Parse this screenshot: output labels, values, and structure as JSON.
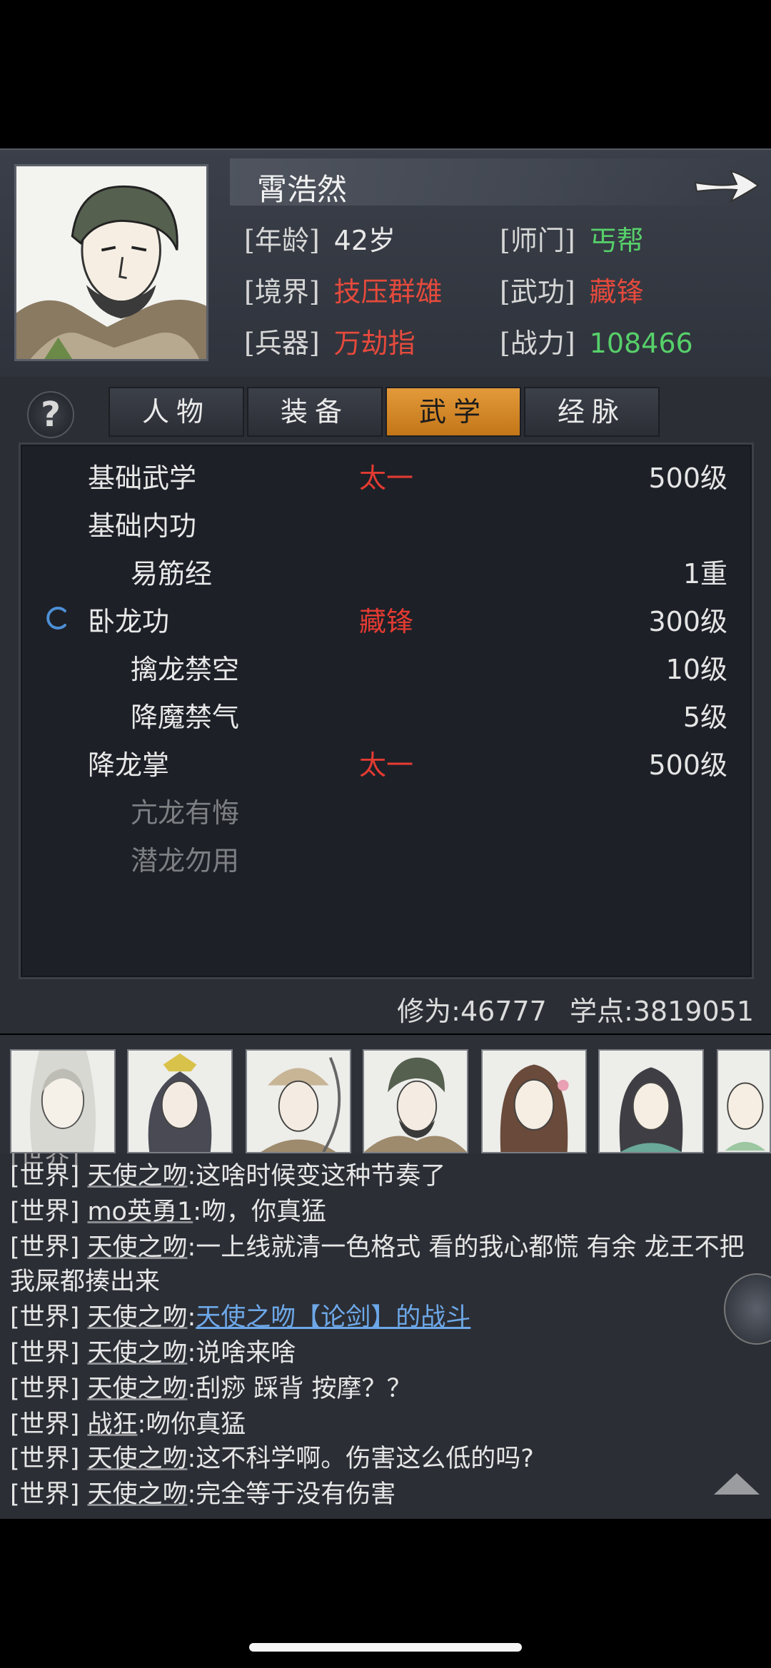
{
  "character": {
    "name": "霄浩然",
    "stats": [
      {
        "label": "[年龄]",
        "value": "42岁",
        "color": "#e8e8e8"
      },
      {
        "label": "[师门]",
        "value": "丐帮",
        "color": "#57d06a"
      },
      {
        "label": "[境界]",
        "value": "技压群雄",
        "color": "#e54a3c"
      },
      {
        "label": "[武功]",
        "value": "藏锋",
        "color": "#e54a3c"
      },
      {
        "label": "[兵器]",
        "value": "万劫指",
        "color": "#e54a3c"
      },
      {
        "label": "[战力]",
        "value": "108466",
        "color": "#57d06a"
      }
    ]
  },
  "help_icon": "?",
  "tabs": [
    {
      "label": "人物",
      "active": false
    },
    {
      "label": "装备",
      "active": false
    },
    {
      "label": "武学",
      "active": true
    },
    {
      "label": "经脉",
      "active": false
    }
  ],
  "skills": [
    {
      "name": "基础武学",
      "rank": "太一",
      "level": "500级",
      "indent": 0
    },
    {
      "name": "基础内功",
      "rank": "",
      "level": "",
      "indent": 0
    },
    {
      "name": "易筋经",
      "rank": "",
      "level": "1重",
      "indent": 1
    },
    {
      "name": "卧龙功",
      "rank": "藏锋",
      "level": "300级",
      "indent": 0,
      "icon": "loading-icon"
    },
    {
      "name": "擒龙禁空",
      "rank": "",
      "level": "10级",
      "indent": 1
    },
    {
      "name": "降魔禁气",
      "rank": "",
      "level": "5级",
      "indent": 1
    },
    {
      "name": "降龙掌",
      "rank": "太一",
      "level": "500级",
      "indent": 0
    },
    {
      "name": "亢龙有悔",
      "rank": "",
      "level": "",
      "indent": 1,
      "dim": true
    },
    {
      "name": "潜龙勿用",
      "rank": "",
      "level": "",
      "indent": 1,
      "dim": true
    }
  ],
  "cultivation": "修为:46777",
  "study_points": "学点:3819051",
  "chat": [
    {
      "channel": "[世界]",
      "user": "天使之吻",
      "text": ":这啥时候变这种节奏了"
    },
    {
      "channel": "[世界]",
      "user": "mo英勇1",
      "text": ":吻，你真猛"
    },
    {
      "channel": "[世界]",
      "user": "天使之吻",
      "text": ":一上线就清一色格式 看的我心都慌 有余 龙王不把我屎都揍出来"
    },
    {
      "channel": "[世界]",
      "user": "天使之吻",
      "text": ":",
      "link": "天使之吻【论剑】的战斗"
    },
    {
      "channel": "[世界]",
      "user": "天使之吻",
      "text": ":说啥来啥"
    },
    {
      "channel": "[世界]",
      "user": "天使之吻",
      "text": ":刮痧 踩背 按摩？？"
    },
    {
      "channel": "[世界]",
      "user": "战狂",
      "text": ":吻你真猛"
    },
    {
      "channel": "[世界]",
      "user": "天使之吻",
      "text": ":这不科学啊。伤害这么低的吗?"
    },
    {
      "channel": "[世界]",
      "user": "天使之吻",
      "text": ":完全等于没有伤害"
    }
  ]
}
